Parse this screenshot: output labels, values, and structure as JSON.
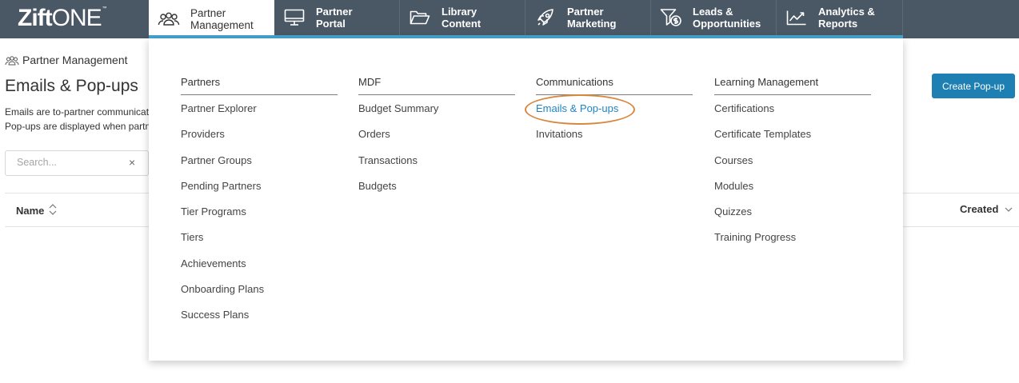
{
  "brand": {
    "name_bold": "Zift",
    "name_light": "ONE",
    "trademark": "™"
  },
  "nav": {
    "items": [
      {
        "label": "Partner\nManagement",
        "icon": "people-icon",
        "active": true
      },
      {
        "label": "Partner\nPortal",
        "icon": "monitor-icon",
        "active": false
      },
      {
        "label": "Library\nContent",
        "icon": "folder-icon",
        "active": false
      },
      {
        "label": "Partner\nMarketing",
        "icon": "rocket-icon",
        "active": false
      },
      {
        "label": "Leads &\nOpportunities",
        "icon": "funnel-dollar-icon",
        "active": false
      },
      {
        "label": "Analytics &\nReports",
        "icon": "trend-chart-icon",
        "active": false
      }
    ]
  },
  "page": {
    "breadcrumb": "Partner Management",
    "title": "Emails & Pop-ups",
    "description_line1": "Emails are to-partner communications",
    "description_line2": "Pop-ups are displayed when partners",
    "search_placeholder": "Search...",
    "clear_symbol": "×",
    "create_button": "Create Pop-up",
    "columns": {
      "name": "Name",
      "created": "Created"
    }
  },
  "menu": {
    "columns": [
      {
        "heading": "Partners",
        "items": [
          "Partner Explorer",
          "Providers",
          "Partner Groups",
          "Pending Partners",
          "Tier Programs",
          "Tiers",
          "Achievements",
          "Onboarding Plans",
          "Success Plans"
        ]
      },
      {
        "heading": "MDF",
        "items": [
          "Budget Summary",
          "Orders",
          "Transactions",
          "Budgets"
        ]
      },
      {
        "heading": "Communications",
        "items": [
          "Emails & Pop-ups",
          "Invitations"
        ]
      },
      {
        "heading": "Learning Management",
        "items": [
          "Certifications",
          "Certificate Templates",
          "Courses",
          "Modules",
          "Quizzes",
          "Training Progress"
        ]
      }
    ],
    "selected_item": "Emails & Pop-ups"
  },
  "colors": {
    "nav_bg": "#4a5764",
    "accent_bar": "#45a3cf",
    "link_active": "#1e85c4",
    "button": "#1e7fb2",
    "annotation_ring": "#d9873f"
  }
}
